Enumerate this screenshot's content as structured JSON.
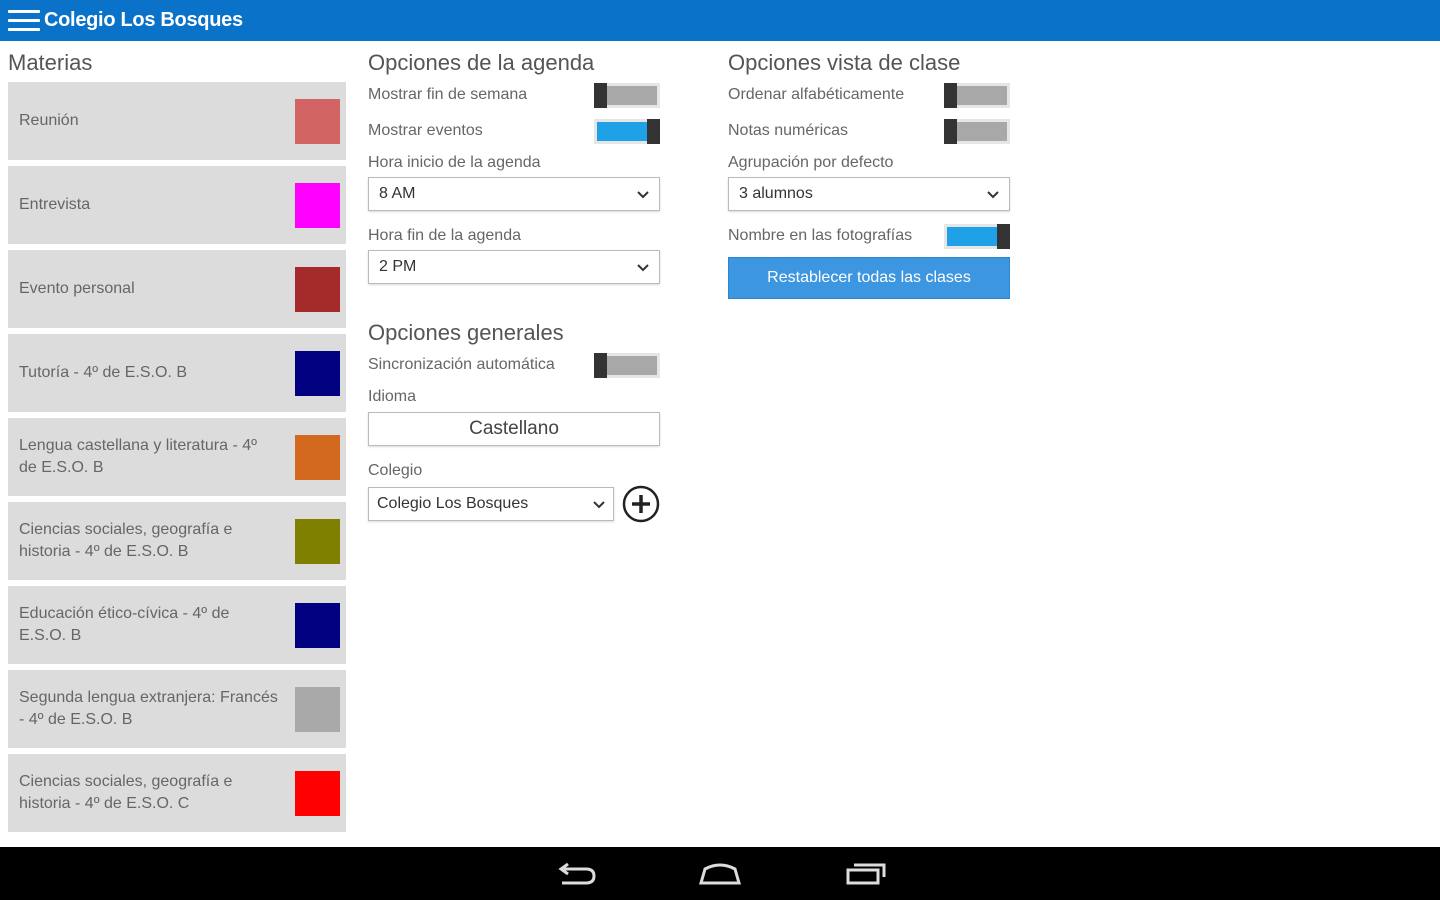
{
  "app": {
    "title": "Colegio Los Bosques"
  },
  "subjects": {
    "title": "Materias",
    "items": [
      {
        "label": "Reunión",
        "color": "#d36464"
      },
      {
        "label": "Entrevista",
        "color": "#ff00ff"
      },
      {
        "label": "Evento personal",
        "color": "#a52a2a"
      },
      {
        "label": "Tutoría - 4º de E.S.O. B",
        "color": "#000080"
      },
      {
        "label": "Lengua castellana y literatura - 4º de E.S.O. B",
        "color": "#d2691e"
      },
      {
        "label": "Ciencias sociales, geografía e historia - 4º de E.S.O. B",
        "color": "#808000"
      },
      {
        "label": "Educación ético-cívica - 4º de E.S.O. B",
        "color": "#000080"
      },
      {
        "label": "Segunda lengua extranjera: Francés - 4º de E.S.O. B",
        "color": "#a9a9a9"
      },
      {
        "label": "Ciencias sociales, geografía e historia - 4º de E.S.O. C",
        "color": "#ff0000"
      }
    ]
  },
  "agenda": {
    "title": "Opciones de la agenda",
    "show_weekend_label": "Mostrar fin de semana",
    "show_events_label": "Mostrar eventos",
    "start_label": "Hora inicio de la agenda",
    "start_value": "8 AM",
    "end_label": "Hora fin de la agenda",
    "end_value": "2 PM"
  },
  "general": {
    "title": "Opciones generales",
    "autosync_label": "Sincronización automática",
    "language_label": "Idioma",
    "language_value": "Castellano",
    "school_label": "Colegio",
    "school_value": "Colegio Los Bosques"
  },
  "classview": {
    "title": "Opciones vista de clase",
    "alpha_label": "Ordenar alfabéticamente",
    "numeric_label": "Notas numéricas",
    "grouping_label": "Agrupación por defecto",
    "grouping_value": "3 alumnos",
    "photo_names_label": "Nombre en las fotografías",
    "reset_button": "Restablecer todas las clases"
  }
}
